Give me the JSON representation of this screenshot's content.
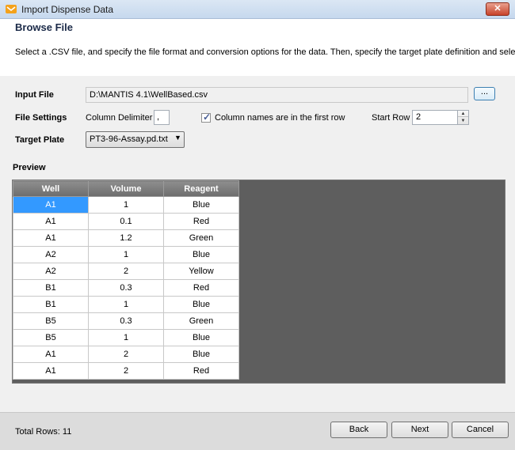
{
  "window": {
    "title": "Import Dispense Data",
    "close_label": "✕"
  },
  "header": {
    "title": "Browse File",
    "description": "Select a .CSV file, and specify the file format and conversion options for the data. Then, specify the target plate definition and select a"
  },
  "form": {
    "input_file_label": "Input File",
    "input_file_value": "D:\\MANTIS 4.1\\WellBased.csv",
    "browse_label": "...",
    "file_settings_label": "File Settings",
    "column_delimiter_label": "Column Delimiter",
    "column_delimiter_value": ",",
    "column_names_label": "Column names are in the first row",
    "column_names_checked": true,
    "start_row_label": "Start Row",
    "start_row_value": "2",
    "target_plate_label": "Target Plate",
    "target_plate_value": "PT3-96-Assay.pd.txt"
  },
  "preview": {
    "label": "Preview",
    "columns": [
      "Well",
      "Volume",
      "Reagent"
    ],
    "rows": [
      [
        "A1",
        "1",
        "Blue"
      ],
      [
        "A1",
        "0.1",
        "Red"
      ],
      [
        "A1",
        "1.2",
        "Green"
      ],
      [
        "A2",
        "1",
        "Blue"
      ],
      [
        "A2",
        "2",
        "Yellow"
      ],
      [
        "B1",
        "0.3",
        "Red"
      ],
      [
        "B1",
        "1",
        "Blue"
      ],
      [
        "B5",
        "0.3",
        "Green"
      ],
      [
        "B5",
        "1",
        "Blue"
      ],
      [
        "A1",
        "2",
        "Blue"
      ],
      [
        "A1",
        "2",
        "Red"
      ]
    ]
  },
  "footer": {
    "total_rows": "Total Rows:  11",
    "back_label": "Back",
    "next_label": "Next",
    "cancel_label": "Cancel"
  },
  "colors": {
    "selection": "#3399ff",
    "grid_background": "#5e5e5e"
  }
}
